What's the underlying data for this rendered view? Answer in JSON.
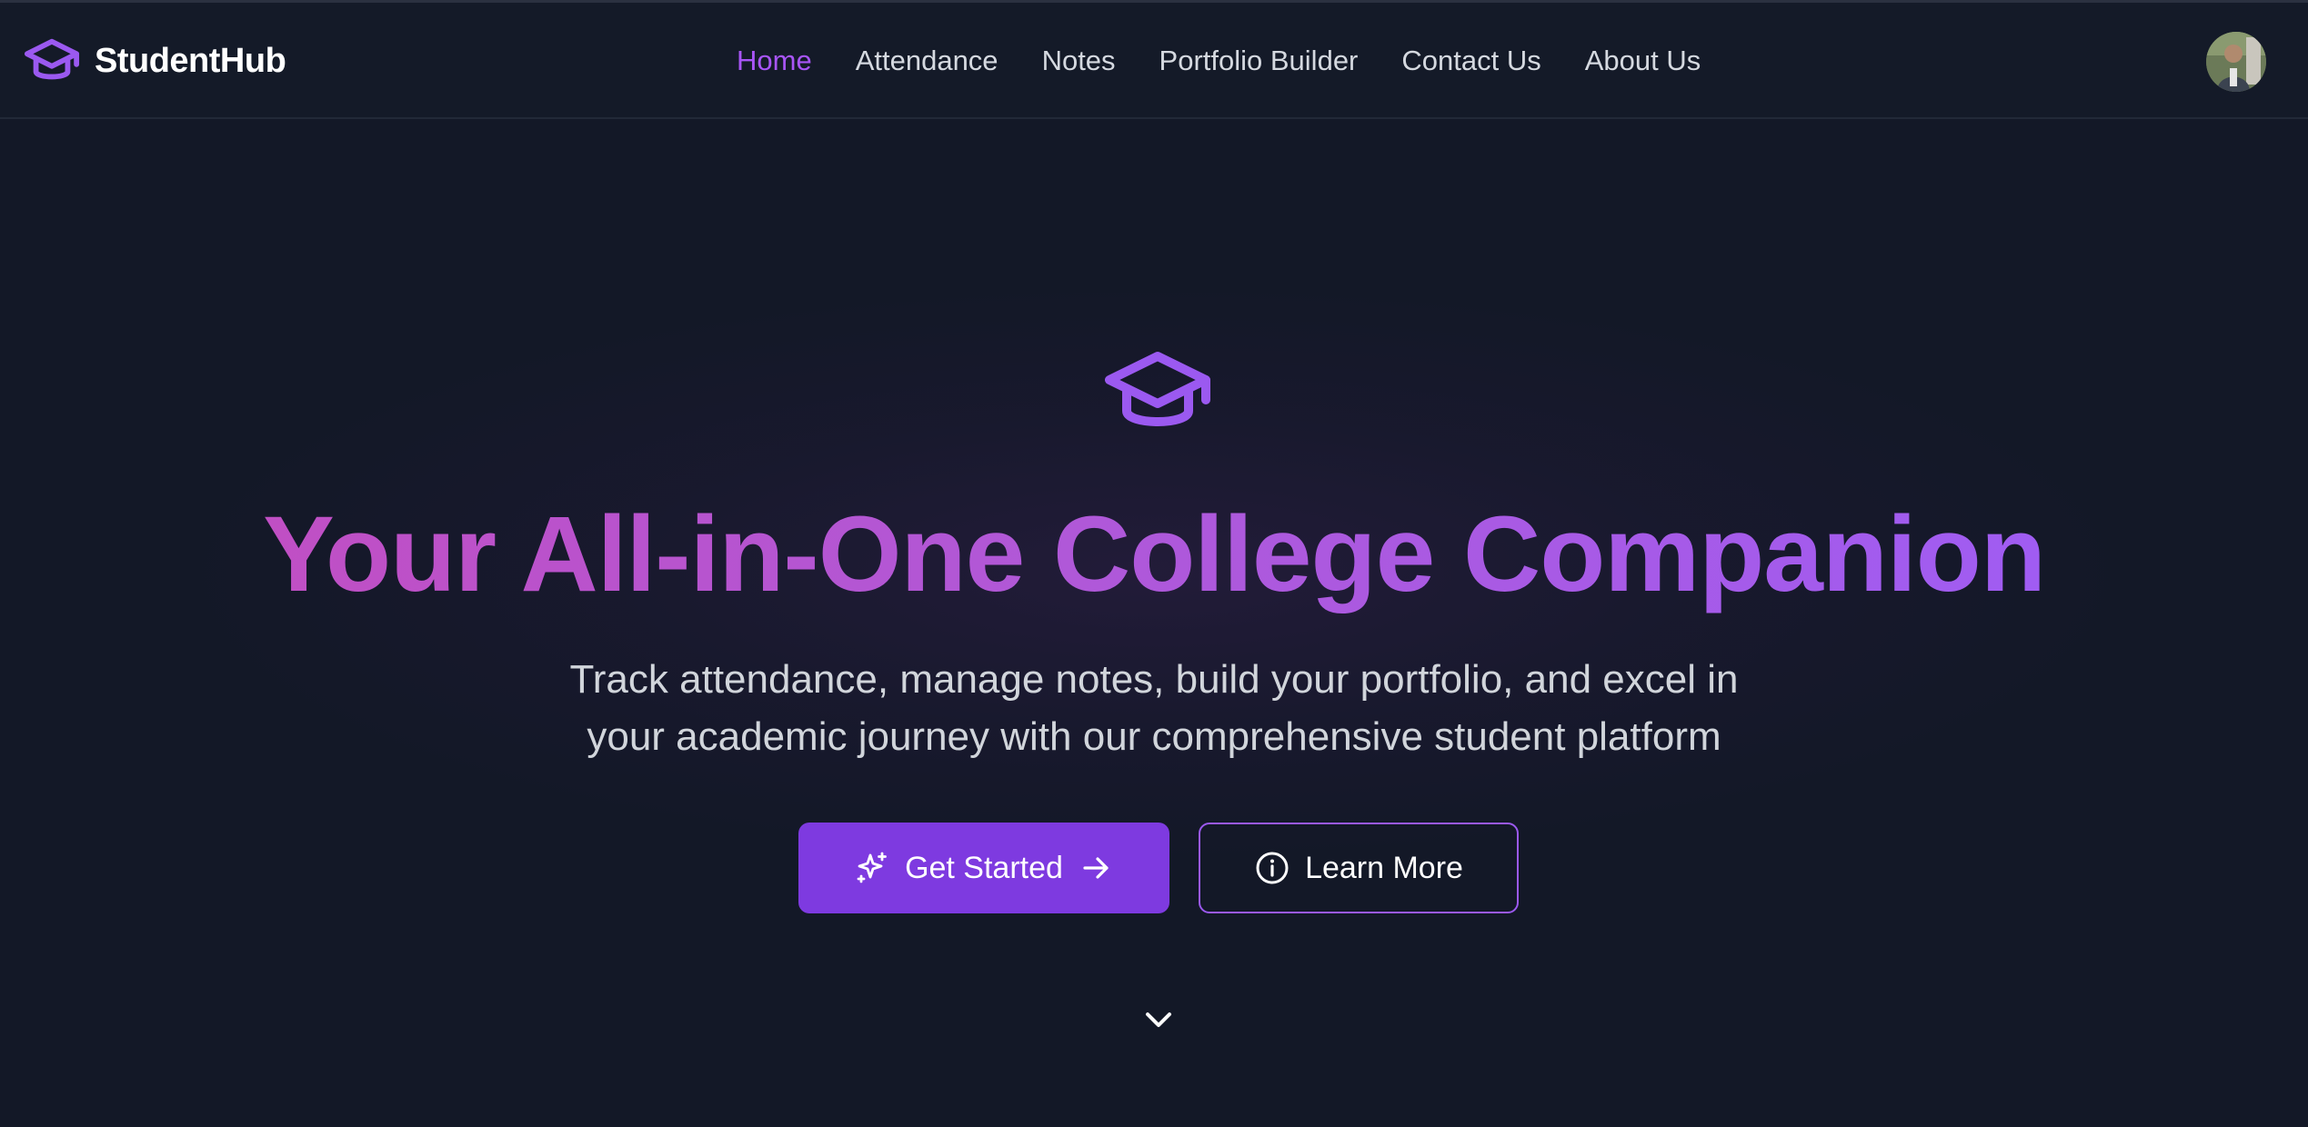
{
  "brand": {
    "name": "StudentHub",
    "icon": "graduation-cap-icon",
    "accent_color": "#a855f7"
  },
  "nav": {
    "items": [
      {
        "label": "Home",
        "active": true
      },
      {
        "label": "Attendance",
        "active": false
      },
      {
        "label": "Notes",
        "active": false
      },
      {
        "label": "Portfolio Builder",
        "active": false
      },
      {
        "label": "Contact Us",
        "active": false
      },
      {
        "label": "About Us",
        "active": false
      }
    ]
  },
  "user": {
    "avatar_icon": "user-avatar"
  },
  "hero": {
    "icon": "graduation-cap-icon",
    "title": "Your All-in-One College Companion",
    "subtitle_line1": "Track attendance, manage notes, build your portfolio, and excel in",
    "subtitle_line2": "your academic journey with our comprehensive student platform",
    "primary_button": {
      "label": "Get Started",
      "icon_left": "sparkles-icon",
      "icon_right": "arrow-right-icon",
      "color": "#7e3ae0"
    },
    "secondary_button": {
      "label": "Learn More",
      "icon_left": "info-circle-icon",
      "border_color": "#9b59f0"
    },
    "scroll_indicator": "chevron-down-icon"
  },
  "colors": {
    "background": "#131827",
    "navbar_background": "#141a28",
    "title_gradient_start": "#c04fc4",
    "title_gradient_end": "#a05cf2"
  }
}
